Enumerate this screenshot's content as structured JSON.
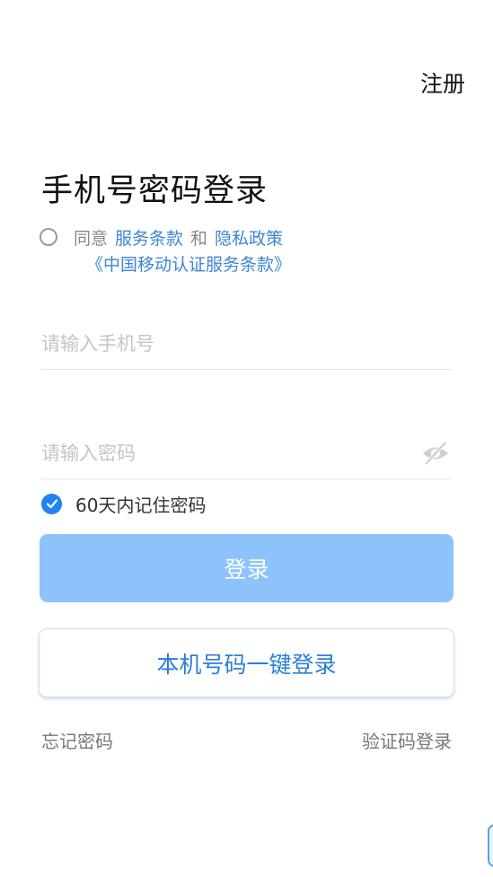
{
  "header": {
    "register_label": "注册"
  },
  "title": "手机号密码登录",
  "agreement": {
    "agree_label": "同意",
    "terms_link": "服务条款",
    "and_label": "和",
    "privacy_link": "隐私政策",
    "cmcc_terms_link": "《中国移动认证服务条款》",
    "checked": false
  },
  "phone_field": {
    "placeholder": "请输入手机号",
    "value": ""
  },
  "password_field": {
    "placeholder": "请输入密码",
    "value": "",
    "toggle_icon": "eye-hidden-icon"
  },
  "remember": {
    "label": "60天内记住密码",
    "checked": true
  },
  "login_button": {
    "label": "登录"
  },
  "one_click_button": {
    "label": "本机号码一键登录"
  },
  "footer": {
    "forgot_password": "忘记密码",
    "sms_login": "验证码登录"
  },
  "colors": {
    "accent": "#1f84f0",
    "link": "#3d86d6",
    "login_button_bg": "#8ec2fb",
    "one_click_text": "#2a7fd6"
  }
}
